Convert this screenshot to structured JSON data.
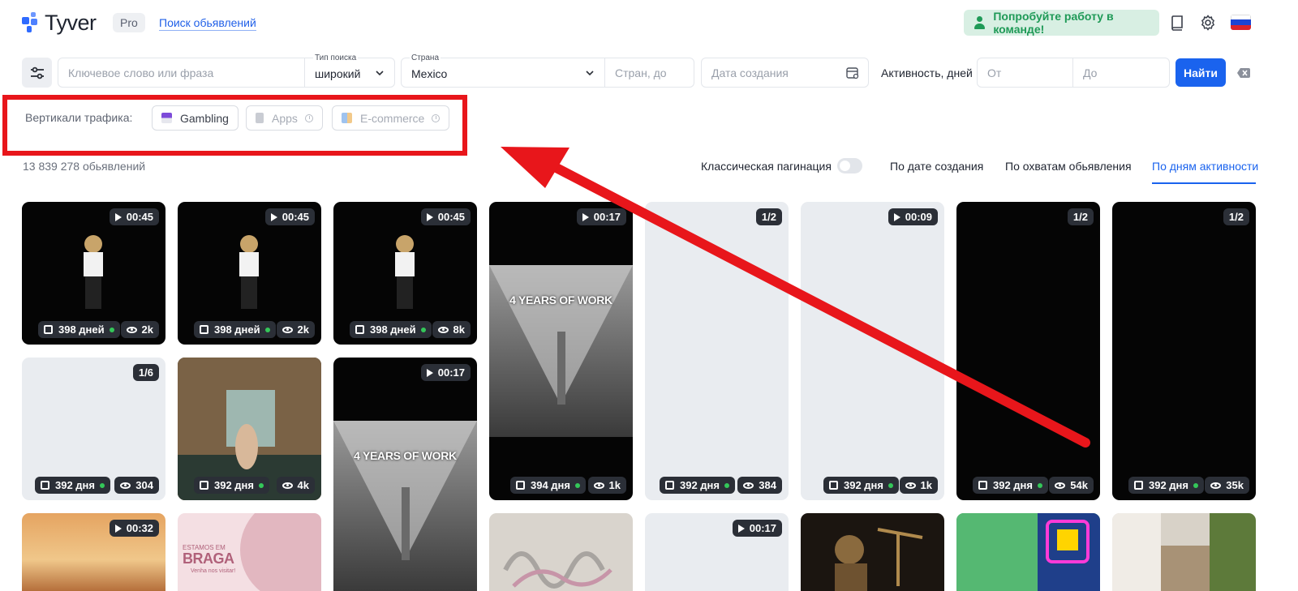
{
  "header": {
    "logo_text": "Tyver",
    "pro_badge": "Pro",
    "search_ads_link": "Поиск обьявлений",
    "team_button": "Попробуйте работу в команде!",
    "icons": [
      "book-icon",
      "gear-icon",
      "flag-ru-icon"
    ]
  },
  "filters": {
    "keyword_placeholder": "Ключевое слово или фраза",
    "search_type_label": "Тип поиска",
    "search_type_value": "широкий",
    "country_label": "Страна",
    "country_value": "Mexico",
    "pages_placeholder": "Стран, до",
    "created_placeholder": "Дата создания",
    "activity_label": "Активность, дней",
    "from_placeholder": "От",
    "to_placeholder": "До",
    "find_button": "Найти"
  },
  "verticals": {
    "label": "Вертикали трафика:",
    "chips": [
      "Gambling",
      "Apps",
      "E-commerce"
    ]
  },
  "results": {
    "count": "13 839 278 обьявлений",
    "classic_pagination": "Классическая пагинация",
    "sort_options": [
      "По дате создания",
      "По охватам обьявления",
      "По дням активности"
    ],
    "active_sort": "По дням активности"
  },
  "cards": [
    {
      "badge": "00:45",
      "days": "398 дней",
      "views": "2k"
    },
    {
      "badge": "00:45",
      "days": "398 дней",
      "views": "2k"
    },
    {
      "badge": "00:45",
      "days": "398 дней",
      "views": "8k"
    },
    {
      "badge": "00:17",
      "days": "394 дня",
      "views": "1k",
      "overlay": "4 YEARS OF WORK"
    },
    {
      "badge": "1/2",
      "days": "392 дня",
      "views": "384"
    },
    {
      "badge": "00:09",
      "days": "392 дня",
      "views": "1k"
    },
    {
      "badge": "1/2",
      "days": "392 дня",
      "views": "54k"
    },
    {
      "badge": "1/2",
      "days": "392 дня",
      "views": "35k"
    },
    {
      "badge": "1/6",
      "days": "392 дня",
      "views": "304"
    },
    {
      "badge": "",
      "days": "392 дня",
      "views": "4k"
    },
    {
      "badge": "00:17",
      "overlay": "4 YEARS OF WORK"
    },
    {
      "badge": "00:32"
    },
    {
      "badge": "",
      "overlay_title": "BRAGA",
      "overlay_pre": "ESTAMOS EM",
      "overlay_sub": "Venha nos visitar!"
    },
    {
      "badge": "00:17"
    }
  ],
  "colors": {
    "accent": "#1a63ee",
    "annotation": "#e8161b",
    "green": "#1f9a57"
  }
}
